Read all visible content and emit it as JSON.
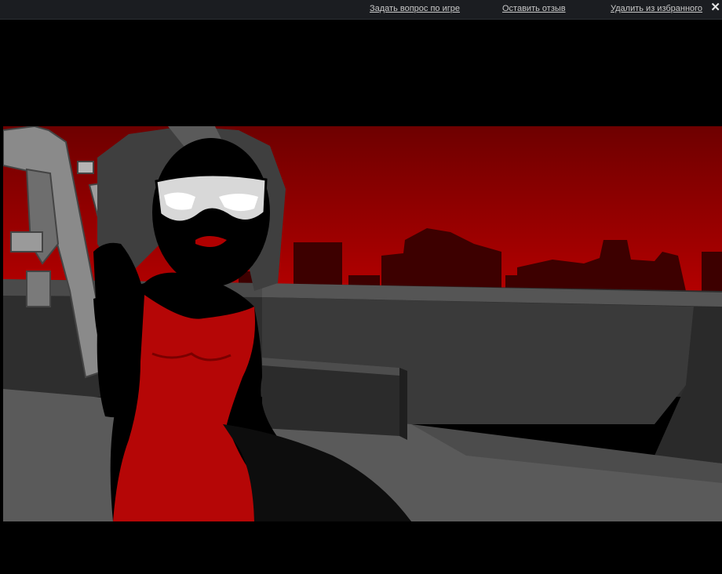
{
  "topbar": {
    "links": [
      {
        "label": "Задать вопрос по игре"
      },
      {
        "label": "Оставить отзыв"
      },
      {
        "label": "Удалить из избранного"
      }
    ],
    "close_glyph": "✕"
  },
  "scene": {
    "sky_top_color": "#7a0000",
    "sky_bottom_color": "#b00000",
    "skyline_color": "#3a0000",
    "rooftop_color": "#4a4a4a",
    "floor_color": "#5c5c5c",
    "dress_color": "#b00606",
    "silhouette_color": "#000000",
    "gun_color": "#8a8a8a"
  }
}
